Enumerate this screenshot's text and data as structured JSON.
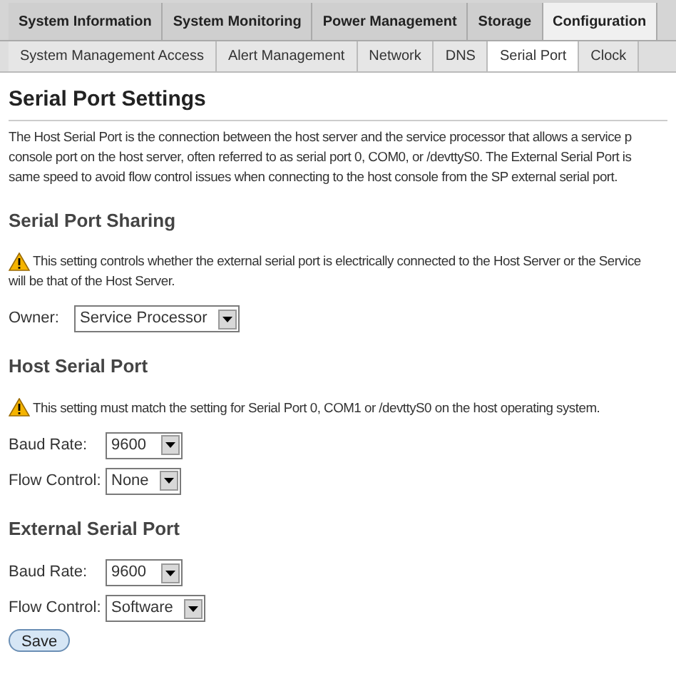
{
  "main_tabs": [
    {
      "label": "System Information",
      "selected": false
    },
    {
      "label": "System Monitoring",
      "selected": false
    },
    {
      "label": "Power Management",
      "selected": false
    },
    {
      "label": "Storage",
      "selected": false
    },
    {
      "label": "Configuration",
      "selected": true
    }
  ],
  "sub_tabs": [
    {
      "label": "System Management Access",
      "selected": false
    },
    {
      "label": "Alert Management",
      "selected": false
    },
    {
      "label": "Network",
      "selected": false
    },
    {
      "label": "DNS",
      "selected": false
    },
    {
      "label": "Serial Port",
      "selected": true
    },
    {
      "label": "Clock",
      "selected": false
    }
  ],
  "title": "Serial Port Settings",
  "intro_lines": [
    "The Host Serial Port is the connection between the host server and the service processor that allows a service p",
    "console port on the host server, often referred to as serial port 0, COM0, or /devttyS0. The External Serial Port is",
    "same speed to avoid flow control issues when connecting to the host console from the SP external serial port."
  ],
  "sections": [
    {
      "heading": "Serial Port Sharing",
      "warning_lines": [
        "This setting controls whether the external serial port is electrically connected to the Host Server or the Service",
        "will be that of the Host Server."
      ],
      "fields": [
        {
          "label": "Owner:",
          "value": "Service Processor"
        }
      ]
    },
    {
      "heading": "Host Serial Port",
      "warning_lines": [
        "This setting must match the setting for Serial Port 0, COM1 or /devttyS0 on the host operating system."
      ],
      "fields": [
        {
          "label": "Baud Rate:",
          "value": "9600"
        },
        {
          "label": "Flow Control:",
          "value": "None"
        }
      ]
    },
    {
      "heading": "External Serial Port",
      "fields": [
        {
          "label": "Baud Rate:",
          "value": "9600"
        },
        {
          "label": "Flow Control:",
          "value": "Software"
        }
      ]
    }
  ],
  "save_button": "Save"
}
